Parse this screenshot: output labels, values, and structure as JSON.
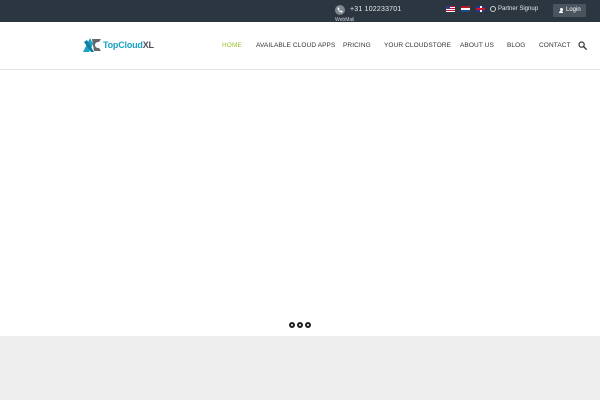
{
  "topbar": {
    "phone": "+31  102233701",
    "webmail": "WebMail",
    "flags": [
      "us-flag",
      "nl-flag",
      "uk-flag"
    ],
    "partner_signup": "Partner Signup",
    "login": "Login"
  },
  "header": {
    "logo": {
      "part1": "TopCloud",
      "part2": "XL"
    },
    "nav": [
      {
        "label": "HOME",
        "active": true
      },
      {
        "label": "AVAILABLE CLOUD APPS",
        "active": false
      },
      {
        "label": "PRICING",
        "active": false
      },
      {
        "label": "YOUR CLOUDSTORE",
        "active": false
      },
      {
        "label": "ABOUT US",
        "active": false
      },
      {
        "label": "BLOG",
        "active": false
      },
      {
        "label": "CONTACT",
        "active": false
      }
    ]
  },
  "slider": {
    "dots": 3
  },
  "colors": {
    "topbar_bg": "#2c3640",
    "accent_active": "#9cc430",
    "logo_blue": "#1aa1c4",
    "footer_bg": "#eeeeee"
  }
}
